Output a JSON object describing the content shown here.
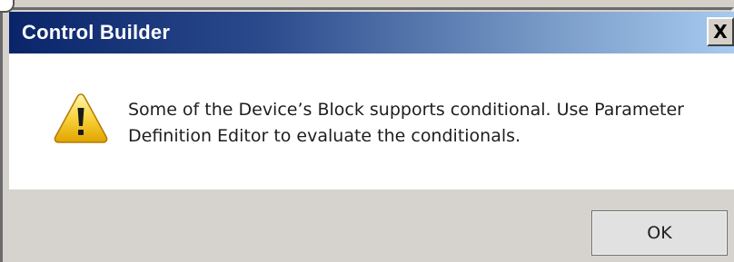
{
  "dialog": {
    "title": "Control Builder",
    "close_label": "X",
    "message_line1": "Some of the Device’s Block supports conditional. Use Parameter",
    "message_line2": "Definition Editor to evaluate the conditionals.",
    "icon": "warning-icon",
    "ok_label": "OK"
  },
  "colors": {
    "titlebar_start": "#0a246a",
    "titlebar_end": "#a6caf0",
    "content_bg": "#ffffff",
    "footer_bg": "#d6d3ce"
  }
}
